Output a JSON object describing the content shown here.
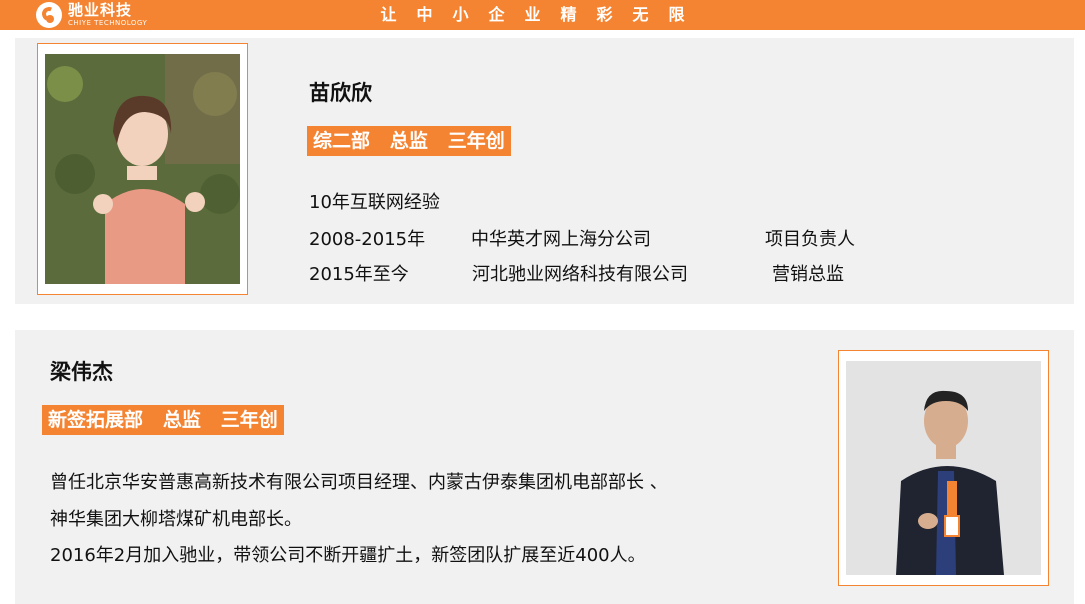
{
  "header": {
    "logo_cn": "驰业科技",
    "logo_en": "CHIYE TECHNOLOGY",
    "slogan": "让中小企业精彩无限"
  },
  "profiles": [
    {
      "name": "苗欣欣",
      "tag": "综二部   总监   三年创",
      "experience": "10年互联网经验",
      "history": [
        {
          "period": "2008-2015年",
          "company": "中华英才网上海分公司",
          "role": "项目负责人"
        },
        {
          "period": "2015年至今",
          "company": "河北驰业网络科技有限公司",
          "role": "营销总监"
        }
      ]
    },
    {
      "name": "梁伟杰",
      "tag": "新签拓展部   总监   三年创",
      "bio": [
        "曾任北京华安普惠高新技术有限公司项目经理、内蒙古伊泰集团机电部部长 、",
        "神华集团大柳塔煤矿机电部长。",
        "2016年2月加入驰业，带领公司不断开疆扩土，新签团队扩展至近400人。"
      ]
    }
  ],
  "colors": {
    "accent": "#f48431",
    "card_bg": "#f1f1f1"
  }
}
